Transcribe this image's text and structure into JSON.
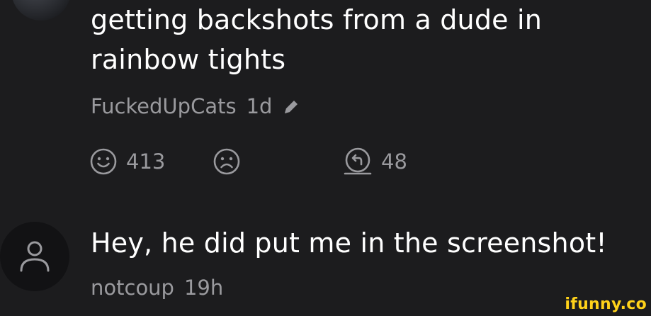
{
  "comments": [
    {
      "text": "getting backshots from a dude in rainbow tights",
      "author": "FuckedUpCats",
      "time": "1d",
      "edited_icon": "pencil-icon",
      "actions": {
        "smile_count": "413",
        "frown_count": "",
        "reply_count": "48"
      },
      "icons": [
        "smile-icon",
        "frown-icon",
        "reply-icon"
      ]
    },
    {
      "text": "Hey, he did put me in the screenshot!",
      "author": "notcoup",
      "time": "19h",
      "avatar_icon": "user-icon"
    }
  ],
  "watermark": "ifunny.co",
  "colors": {
    "background": "#1c1c1e",
    "text": "#ffffff",
    "muted": "#9a9a9e",
    "watermark": "#ffd21a"
  }
}
